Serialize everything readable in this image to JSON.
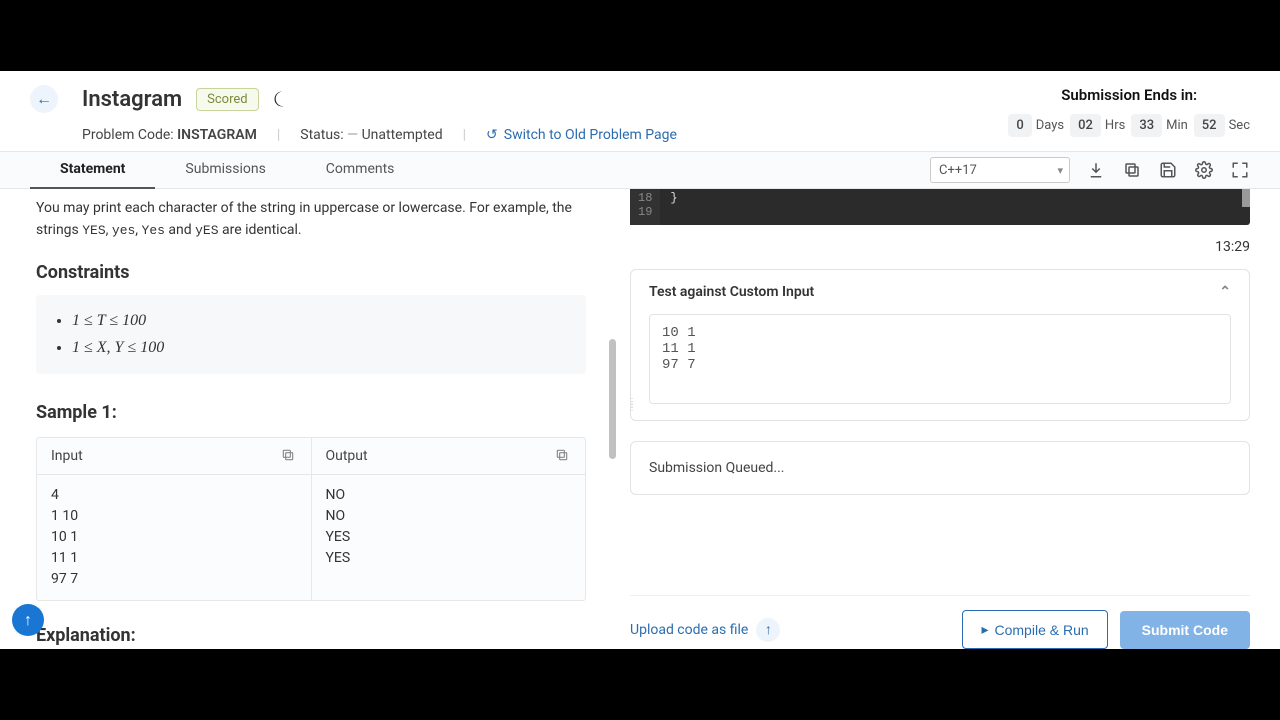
{
  "header": {
    "title": "Instagram",
    "badge": "Scored",
    "problem_code_label": "Problem Code:",
    "problem_code": "INSTAGRAM",
    "status_label": "Status:",
    "status_dash": "—",
    "status_value": "Unattempted",
    "switch_link": "Switch to Old Problem Page"
  },
  "timer": {
    "title": "Submission Ends in:",
    "days_val": "0",
    "days_lbl": "Days",
    "hrs_val": "02",
    "hrs_lbl": "Hrs",
    "min_val": "33",
    "min_lbl": "Min",
    "sec_val": "52",
    "sec_lbl": "Sec"
  },
  "tabs": {
    "statement": "Statement",
    "submissions": "Submissions",
    "comments": "Comments"
  },
  "toolbar": {
    "lang": "C++17"
  },
  "statement": {
    "desc_pre": "You may print each character of the string in uppercase or lowercase. For example, the strings ",
    "y1": "YES",
    "c1": ", ",
    "y2": "yes",
    "c2": ", ",
    "y3": "Yes",
    "c3": " and ",
    "y4": "yES",
    "desc_post": " are identical.",
    "constraints_title": "Constraints",
    "constraint1": "1 ≤ T ≤ 100",
    "constraint2": "1 ≤ X, Y ≤ 100",
    "sample_title": "Sample 1:",
    "input_label": "Input",
    "output_label": "Output",
    "input_body": "4\n1 10\n10 1\n11 1\n97 7",
    "output_body": "NO\nNO\nYES\nYES",
    "explanation_title": "Explanation:"
  },
  "editor": {
    "line18": "18",
    "line19": "19",
    "code18": "}",
    "timestamp": "13:29"
  },
  "custom": {
    "title": "Test against Custom Input",
    "body": "10 1\n11 1\n97 7"
  },
  "queue": {
    "text": "Submission Queued..."
  },
  "bottom": {
    "upload": "Upload code as file",
    "compile": "Compile & Run",
    "submit": "Submit Code"
  }
}
